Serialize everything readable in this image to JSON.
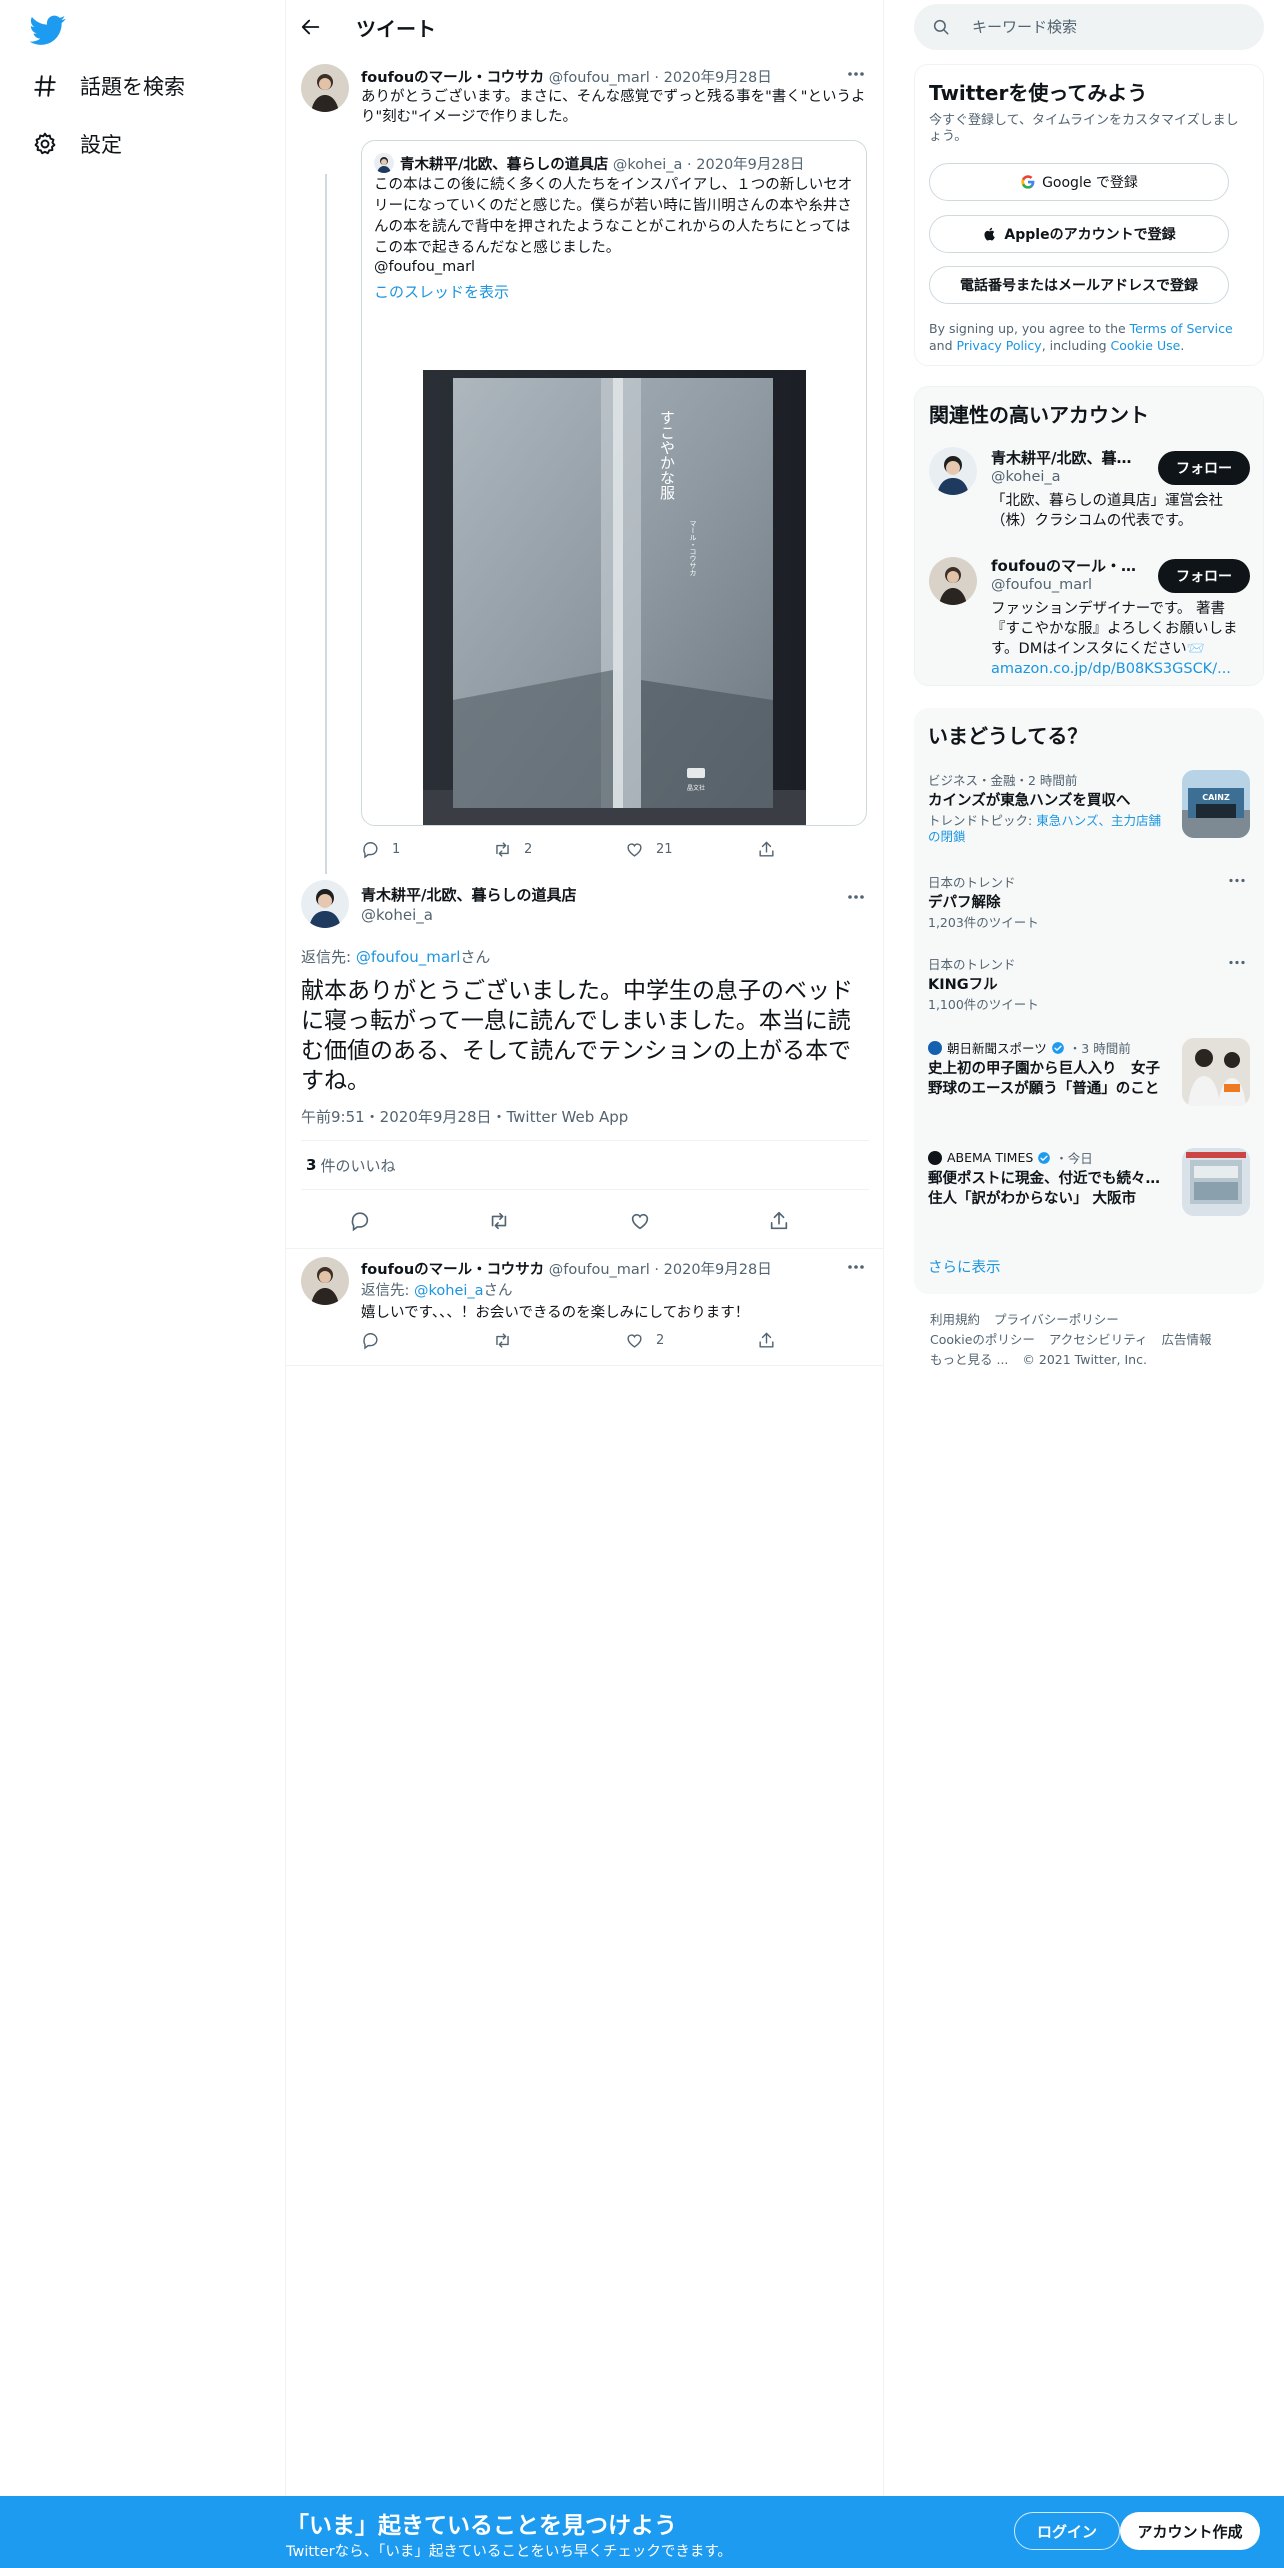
{
  "nav": {
    "logo_icon": "twitter-bird-icon",
    "explore_label": "話題を検索",
    "settings_label": "設定"
  },
  "header": {
    "title": "ツイート"
  },
  "tweet1": {
    "name": "foufouのマール・コウサカ",
    "handle": "@foufou_marl",
    "date": "2020年9月28日",
    "text": "ありがとうございます。まさに、そんな感覚でずっと残る事を\"書く\"というより\"刻む\"イメージで作りました。",
    "quote": {
      "name": "青木耕平/北欧、暮らしの道具店",
      "handle": "@kohei_a",
      "date": "2020年9月28日",
      "text": "この本はこの後に続く多くの人たちをインスパイアし、１つの新しいセオリーになっていくのだと感じた。僕らが若い時に皆川明さんの本や糸井さんの本を読んで背中を押されたようなことがこれからの人たちにとってはこの本で起きるんだなと感じました。",
      "mention": "@foufou_marl",
      "thread_link": "このスレッドを表示",
      "book_title": "すこやかな服",
      "book_author": "マール・コウサカ",
      "book_publisher": "晶文社"
    },
    "replies": "1",
    "retweets": "2",
    "likes": "21"
  },
  "tweet2": {
    "name": "青木耕平/北欧、暮らしの道具店",
    "handle": "@kohei_a",
    "reply_prefix": "返信先: ",
    "reply_to": "@foufou_marl",
    "reply_suffix": "さん",
    "text": "献本ありがとうございました。中学生の息子のベッドに寝っ転がって一息に読んでしまいました。本当に読む価値のある、そして読んでテンションの上がる本ですね。",
    "meta": "午前9:51・2020年9月28日・Twitter Web App",
    "likes_count": "3",
    "likes_label": "件のいいね"
  },
  "tweet3": {
    "name": "foufouのマール・コウサカ",
    "handle": "@foufou_marl",
    "date": "2020年9月28日",
    "reply_prefix": "返信先: ",
    "reply_to": "@kohei_a",
    "reply_suffix": "さん",
    "text": "嬉しいです、、、！お会いできるのを楽しみにしております！",
    "replies": "",
    "retweets": "",
    "likes": "2"
  },
  "search": {
    "placeholder": "キーワード検索"
  },
  "signup": {
    "title": "Twitterを使ってみよう",
    "desc": "今すぐ登録して、タイムラインをカスタマイズしましょう。",
    "google": "Google で登録",
    "apple": "Appleのアカウントで登録",
    "phone": "電話番号またはメールアドレスで登録",
    "terms_1": "By signing up, you agree to the ",
    "terms_tos": "Terms of Service",
    "terms_2": " and ",
    "terms_pp": "Privacy Policy",
    "terms_3": ", including ",
    "terms_cookie": "Cookie Use",
    "terms_4": "."
  },
  "related": {
    "title": "関連性の高いアカウント",
    "accounts": [
      {
        "name": "青木耕平/北欧、暮ら...",
        "handle": "@kohei_a",
        "bio": "「北欧、暮らしの道具店」運営会社（株）クラシコムの代表です。",
        "follow": "フォロー"
      },
      {
        "name": "foufouのマール・コ...",
        "handle": "@foufou_marl",
        "bio": "ファッションデザイナーです。 著書『すこやかな服』よろしくお願いします。DMはインスタにください📨",
        "link": "amazon.co.jp/dp/B08KS3GSCK/...",
        "follow": "フォロー"
      }
    ]
  },
  "trends": {
    "title": "いまどうしてる？",
    "items": [
      {
        "meta": "ビジネス・金融・2 時間前",
        "title": "カインズが東急ハンズを買収へ",
        "sub_prefix": "トレンドトピック: ",
        "sub_links": "東急ハンズ、主力店舗の閉鎖",
        "thumb_text": "CAINZ"
      },
      {
        "meta": "日本のトレンド",
        "title": "デパフ解除",
        "sub": "1,203件のツイート"
      },
      {
        "meta": "日本のトレンド",
        "title": "KINGフル",
        "sub": "1,100件のツイート"
      },
      {
        "source": "朝日新聞スポーツ",
        "time": "・3 時間前",
        "title": "史上初の甲子園から巨人入り　女子野球のエースが願う「普通」のこと"
      },
      {
        "source": "ABEMA TIMES",
        "time": "・今日",
        "title": "郵便ポストに現金、付近でも続々…住人「訳がわからない」 大阪市"
      }
    ],
    "show_more": "さらに表示"
  },
  "footer": {
    "links": [
      "利用規約",
      "プライバシーポリシー",
      "Cookieのポリシー",
      "アクセシビリティ",
      "広告情報",
      "もっと見る ..."
    ],
    "copyright": "© 2021 Twitter, Inc."
  },
  "bottom_bar": {
    "title": "「いま」起きていることを見つけよう",
    "sub": "Twitterなら、「いま」起きていることをいち早くチェックできます。",
    "login": "ログイン",
    "signup": "アカウント作成"
  },
  "colors": {
    "accent": "#1d9bf0",
    "link": "#1b95e0",
    "text": "#0f1419",
    "muted": "#536471"
  }
}
